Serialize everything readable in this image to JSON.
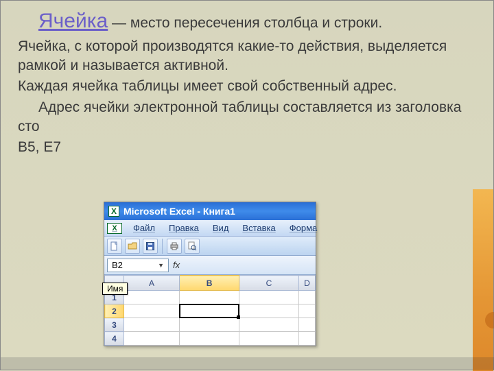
{
  "slide": {
    "heading": "Ячейка",
    "intro_rest": " — место пересечения столбца и строки.",
    "p2": "Ячейка, с которой производятся какие-то действия, выделяется рамкой и называется активной.",
    "p3": "Каждая ячейка таблицы имеет свой собственный адрес.",
    "p4a": "Адрес ячейки электронной таблицы составляется из заголовка сто",
    "p4b": ",",
    "p5": "B5, E7"
  },
  "excel": {
    "title": "Microsoft Excel - Книга1",
    "app_icon": "X",
    "menu": [
      "Файл",
      "Правка",
      "Вид",
      "Вставка",
      "Форма"
    ],
    "namebox_value": "B2",
    "fx_label": "fx",
    "tooltip": "Имя",
    "columns": [
      "",
      "A",
      "B",
      "C",
      "D"
    ],
    "rows": [
      "1",
      "2",
      "3",
      "4"
    ],
    "selected_col": "B",
    "selected_row": "2"
  }
}
